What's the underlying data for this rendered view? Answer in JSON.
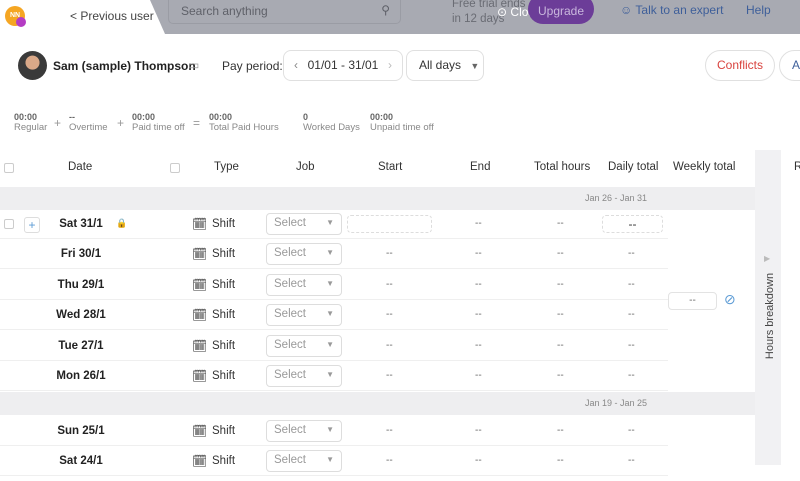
{
  "topbar": {
    "previous_user": "< Previous user",
    "search_placeholder": "Search anything",
    "trial_line1": "Free trial ends",
    "trial_line2": "in 12 days",
    "close": "Close",
    "upgrade": "Upgrade",
    "talk": "Talk to an expert",
    "help": "Help",
    "logo": "NN"
  },
  "header": {
    "employee": "Sam (sample) Thompson",
    "pay_period_label": "Pay period:",
    "period": "01/01 - 31/01",
    "days_filter": "All days",
    "conflicts": "Conflicts",
    "add_partial": "A"
  },
  "summary": [
    {
      "value": "00:00",
      "label": "Regular"
    },
    {
      "op": "+"
    },
    {
      "value": "--",
      "label": "Overtime"
    },
    {
      "op": "+"
    },
    {
      "value": "00:00",
      "label": "Paid time off"
    },
    {
      "op": "="
    },
    {
      "value": "00:00",
      "label": "Total Paid Hours"
    },
    {
      "value": "0",
      "label": "Worked Days"
    },
    {
      "value": "00:00",
      "label": "Unpaid time off"
    }
  ],
  "columns": [
    "Date",
    "Type",
    "Job",
    "Start",
    "End",
    "Total hours",
    "Daily total",
    "Weekly total",
    "R"
  ],
  "weeks": [
    {
      "range": "Jan 26 - Jan 31",
      "weekly_total": "--",
      "rows": [
        {
          "date": "Sat 31/1",
          "type": "Shift",
          "job": "Select",
          "start": "",
          "end": "--",
          "total": "--",
          "daily": "--",
          "locked": true
        },
        {
          "date": "Fri 30/1",
          "type": "Shift",
          "job": "Select",
          "start": "--",
          "end": "--",
          "total": "--",
          "daily": "--"
        },
        {
          "date": "Thu 29/1",
          "type": "Shift",
          "job": "Select",
          "start": "--",
          "end": "--",
          "total": "--",
          "daily": "--"
        },
        {
          "date": "Wed 28/1",
          "type": "Shift",
          "job": "Select",
          "start": "--",
          "end": "--",
          "total": "--",
          "daily": "--"
        },
        {
          "date": "Tue 27/1",
          "type": "Shift",
          "job": "Select",
          "start": "--",
          "end": "--",
          "total": "--",
          "daily": "--"
        },
        {
          "date": "Mon 26/1",
          "type": "Shift",
          "job": "Select",
          "start": "--",
          "end": "--",
          "total": "--",
          "daily": "--"
        }
      ]
    },
    {
      "range": "Jan 19 - Jan 25",
      "rows": [
        {
          "date": "Sun 25/1",
          "type": "Shift",
          "job": "Select",
          "start": "--",
          "end": "--",
          "total": "--",
          "daily": "--"
        },
        {
          "date": "Sat 24/1",
          "type": "Shift",
          "job": "Select",
          "start": "--",
          "end": "--",
          "total": "--",
          "daily": "--"
        }
      ]
    }
  ],
  "side_panel": {
    "label": "Hours breakdown"
  },
  "colors": {
    "upgrade": "#6c3d98",
    "link": "#3e5f9a",
    "conflicts": "#d9433e",
    "accent": "#5b9bd5"
  }
}
